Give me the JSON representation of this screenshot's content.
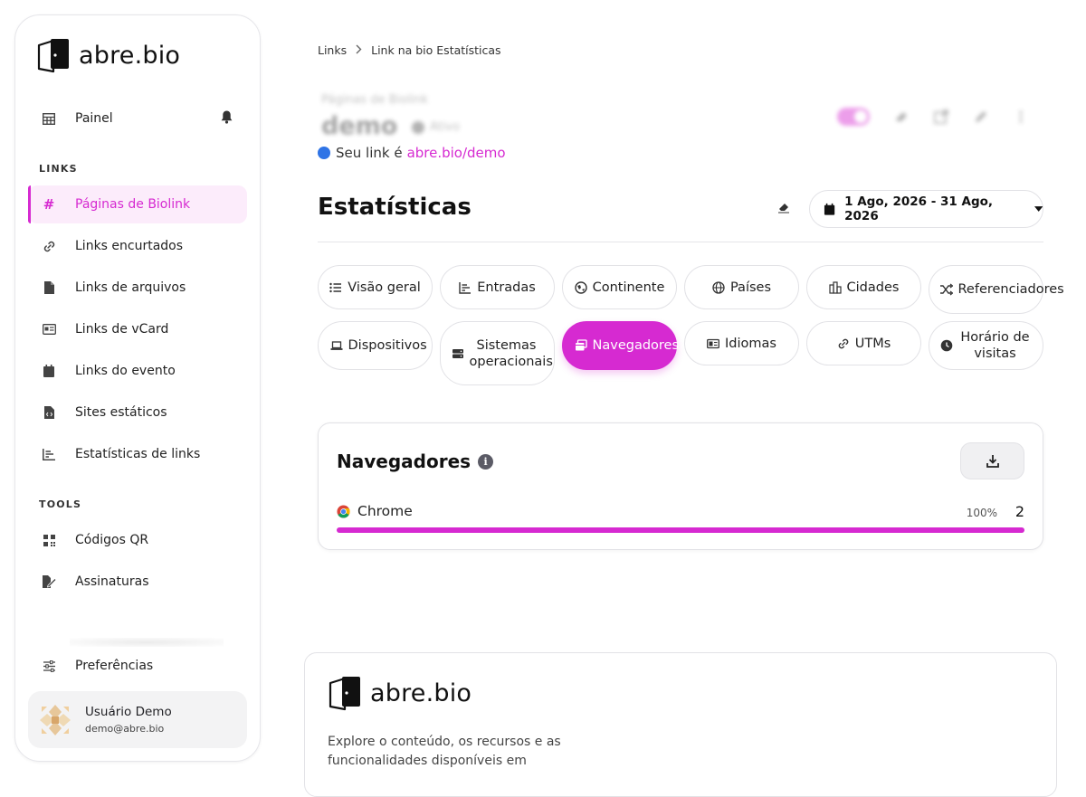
{
  "brand": {
    "name": "abre.bio"
  },
  "sidebar": {
    "painel": "Painel",
    "links_section": "LINKS",
    "items": [
      {
        "label": "Páginas de Biolink",
        "icon": "hashtag-icon",
        "active": true
      },
      {
        "label": "Links encurtados",
        "icon": "link-icon"
      },
      {
        "label": "Links de arquivos",
        "icon": "file-icon"
      },
      {
        "label": "Links de vCard",
        "icon": "id-card-icon"
      },
      {
        "label": "Links do evento",
        "icon": "calendar-icon"
      },
      {
        "label": "Sites estáticos",
        "icon": "file-code-icon"
      },
      {
        "label": "Estatísticas de links",
        "icon": "chart-icon"
      }
    ],
    "tools_section": "TOOLS",
    "tools": [
      {
        "label": "Códigos QR",
        "icon": "qr-icon"
      },
      {
        "label": "Assinaturas",
        "icon": "signature-icon"
      }
    ],
    "preferences": "Preferências",
    "user": {
      "name": "Usuário Demo",
      "email": "demo@abre.bio"
    }
  },
  "breadcrumb": {
    "root": "Links",
    "current": "Link na bio Estatísticas"
  },
  "header": {
    "subtitle": "Páginas de Biolink",
    "title": "demo",
    "status": "Ativo",
    "link_prefix": "Seu link é",
    "link_url": "abre.bio/demo"
  },
  "stats": {
    "title": "Estatísticas",
    "date_range": "1 Ago, 2026 - 31 Ago, 2026"
  },
  "tabs": [
    {
      "label": "Visão geral",
      "icon": "list-icon"
    },
    {
      "label": "Entradas",
      "icon": "chart-icon"
    },
    {
      "label": "Continente",
      "icon": "globe-europe-icon"
    },
    {
      "label": "Países",
      "icon": "globe-icon"
    },
    {
      "label": "Cidades",
      "icon": "city-icon"
    },
    {
      "label": "Referenciadores",
      "icon": "random-icon"
    },
    {
      "label": "Dispositivos",
      "icon": "laptop-icon"
    },
    {
      "label": "Sistemas operacionais",
      "icon": "server-icon"
    },
    {
      "label": "Navegadores",
      "icon": "window-icon",
      "active": true
    },
    {
      "label": "Idiomas",
      "icon": "language-icon"
    },
    {
      "label": "UTMs",
      "icon": "link-icon"
    },
    {
      "label": "Horário de visitas",
      "icon": "clock-icon"
    }
  ],
  "browsers_card": {
    "title": "Navegadores",
    "rows": [
      {
        "name": "Chrome",
        "percent": "100%",
        "count": "2",
        "fraction": 1.0
      }
    ]
  },
  "footer": {
    "text": "Explore o conteúdo, os recursos e as funcionalidades disponíveis em"
  },
  "colors": {
    "accent": "#d62ad1",
    "link_dot": "#2f74e6"
  }
}
